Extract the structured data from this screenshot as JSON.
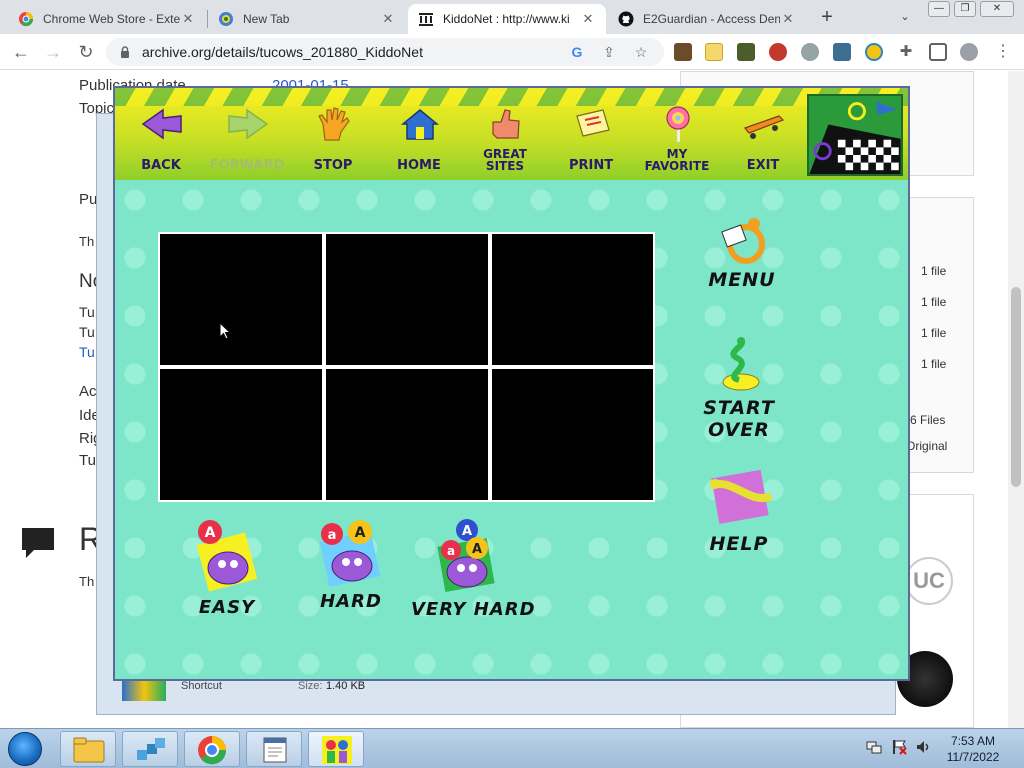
{
  "browser": {
    "tabs": [
      {
        "title": "Chrome Web Store - Exte",
        "icon": "chrome-webstore-icon",
        "active": false
      },
      {
        "title": "New Tab",
        "icon": "new-tab-icon",
        "active": false
      },
      {
        "title": "KiddoNet : http://www.ki",
        "icon": "archive-icon",
        "active": true
      },
      {
        "title": "E2Guardian - Access Den",
        "icon": "github-icon",
        "active": false
      }
    ],
    "address": "archive.org/details/tucows_201880_KiddoNet",
    "window_controls": {
      "minimize": "—",
      "restore": "❐",
      "close": "✕"
    }
  },
  "background_page": {
    "left_labels": [
      "Publication date",
      "Topics",
      "Pu",
      "Th",
      "No",
      "Tu",
      "Tu",
      "Tu",
      "Ac",
      "Ide",
      "Rig",
      "Tu",
      "R",
      "Th"
    ],
    "pub_date": "2001-01-15",
    "file_counts": [
      "1 file",
      "1 file",
      "1 file",
      "1 file",
      "6 Files",
      "Original"
    ],
    "shortcut_name": "Shortcut",
    "shortcut_size_label": "Size:",
    "shortcut_size": "1.40 KB"
  },
  "app": {
    "toolbar": [
      {
        "key": "back",
        "label": "BACK",
        "icon": "back-arrow-icon",
        "enabled": true
      },
      {
        "key": "forward",
        "label": "FORWARD",
        "icon": "forward-arrow-icon",
        "enabled": false
      },
      {
        "key": "stop",
        "label": "STOP",
        "icon": "stop-hand-icon",
        "enabled": true
      },
      {
        "key": "home",
        "label": "HOME",
        "icon": "home-icon",
        "enabled": true
      },
      {
        "key": "great-sites",
        "label": "GREAT SITES",
        "icon": "thumbs-up-icon",
        "enabled": true
      },
      {
        "key": "print",
        "label": "PRINT",
        "icon": "print-icon",
        "enabled": true
      },
      {
        "key": "my-favorite",
        "label": "MY FAVORITE",
        "icon": "lollipop-icon",
        "enabled": true
      },
      {
        "key": "exit",
        "label": "EXIT",
        "icon": "skateboard-icon",
        "enabled": true
      }
    ],
    "side_buttons": [
      {
        "key": "menu",
        "label": "MENU",
        "icon": "snake-menu-icon"
      },
      {
        "key": "start-over",
        "label": "START OVER",
        "icon": "snake-start-over-icon"
      },
      {
        "key": "help",
        "label": "HELP",
        "icon": "snake-help-icon"
      }
    ],
    "levels": [
      {
        "key": "easy",
        "label": "EASY",
        "icon": "monster-easy-icon",
        "balloons": [
          "A"
        ]
      },
      {
        "key": "hard",
        "label": "HARD",
        "icon": "monster-hard-icon",
        "balloons": [
          "a",
          "A"
        ]
      },
      {
        "key": "very-hard",
        "label": "VERY HARD",
        "icon": "monster-very-hard-icon",
        "balloons": [
          "A",
          "a",
          "A"
        ]
      }
    ],
    "colors": {
      "toolbar_label": "#2a1a6a",
      "play_background": "#7ee6c8",
      "cell": "#000000"
    }
  },
  "taskbar": {
    "apps": [
      "explorer-icon",
      "network-icon",
      "chrome-icon",
      "notepad-icon",
      "kiddonet-icon"
    ],
    "time": "7:53 AM",
    "date": "11/7/2022"
  }
}
